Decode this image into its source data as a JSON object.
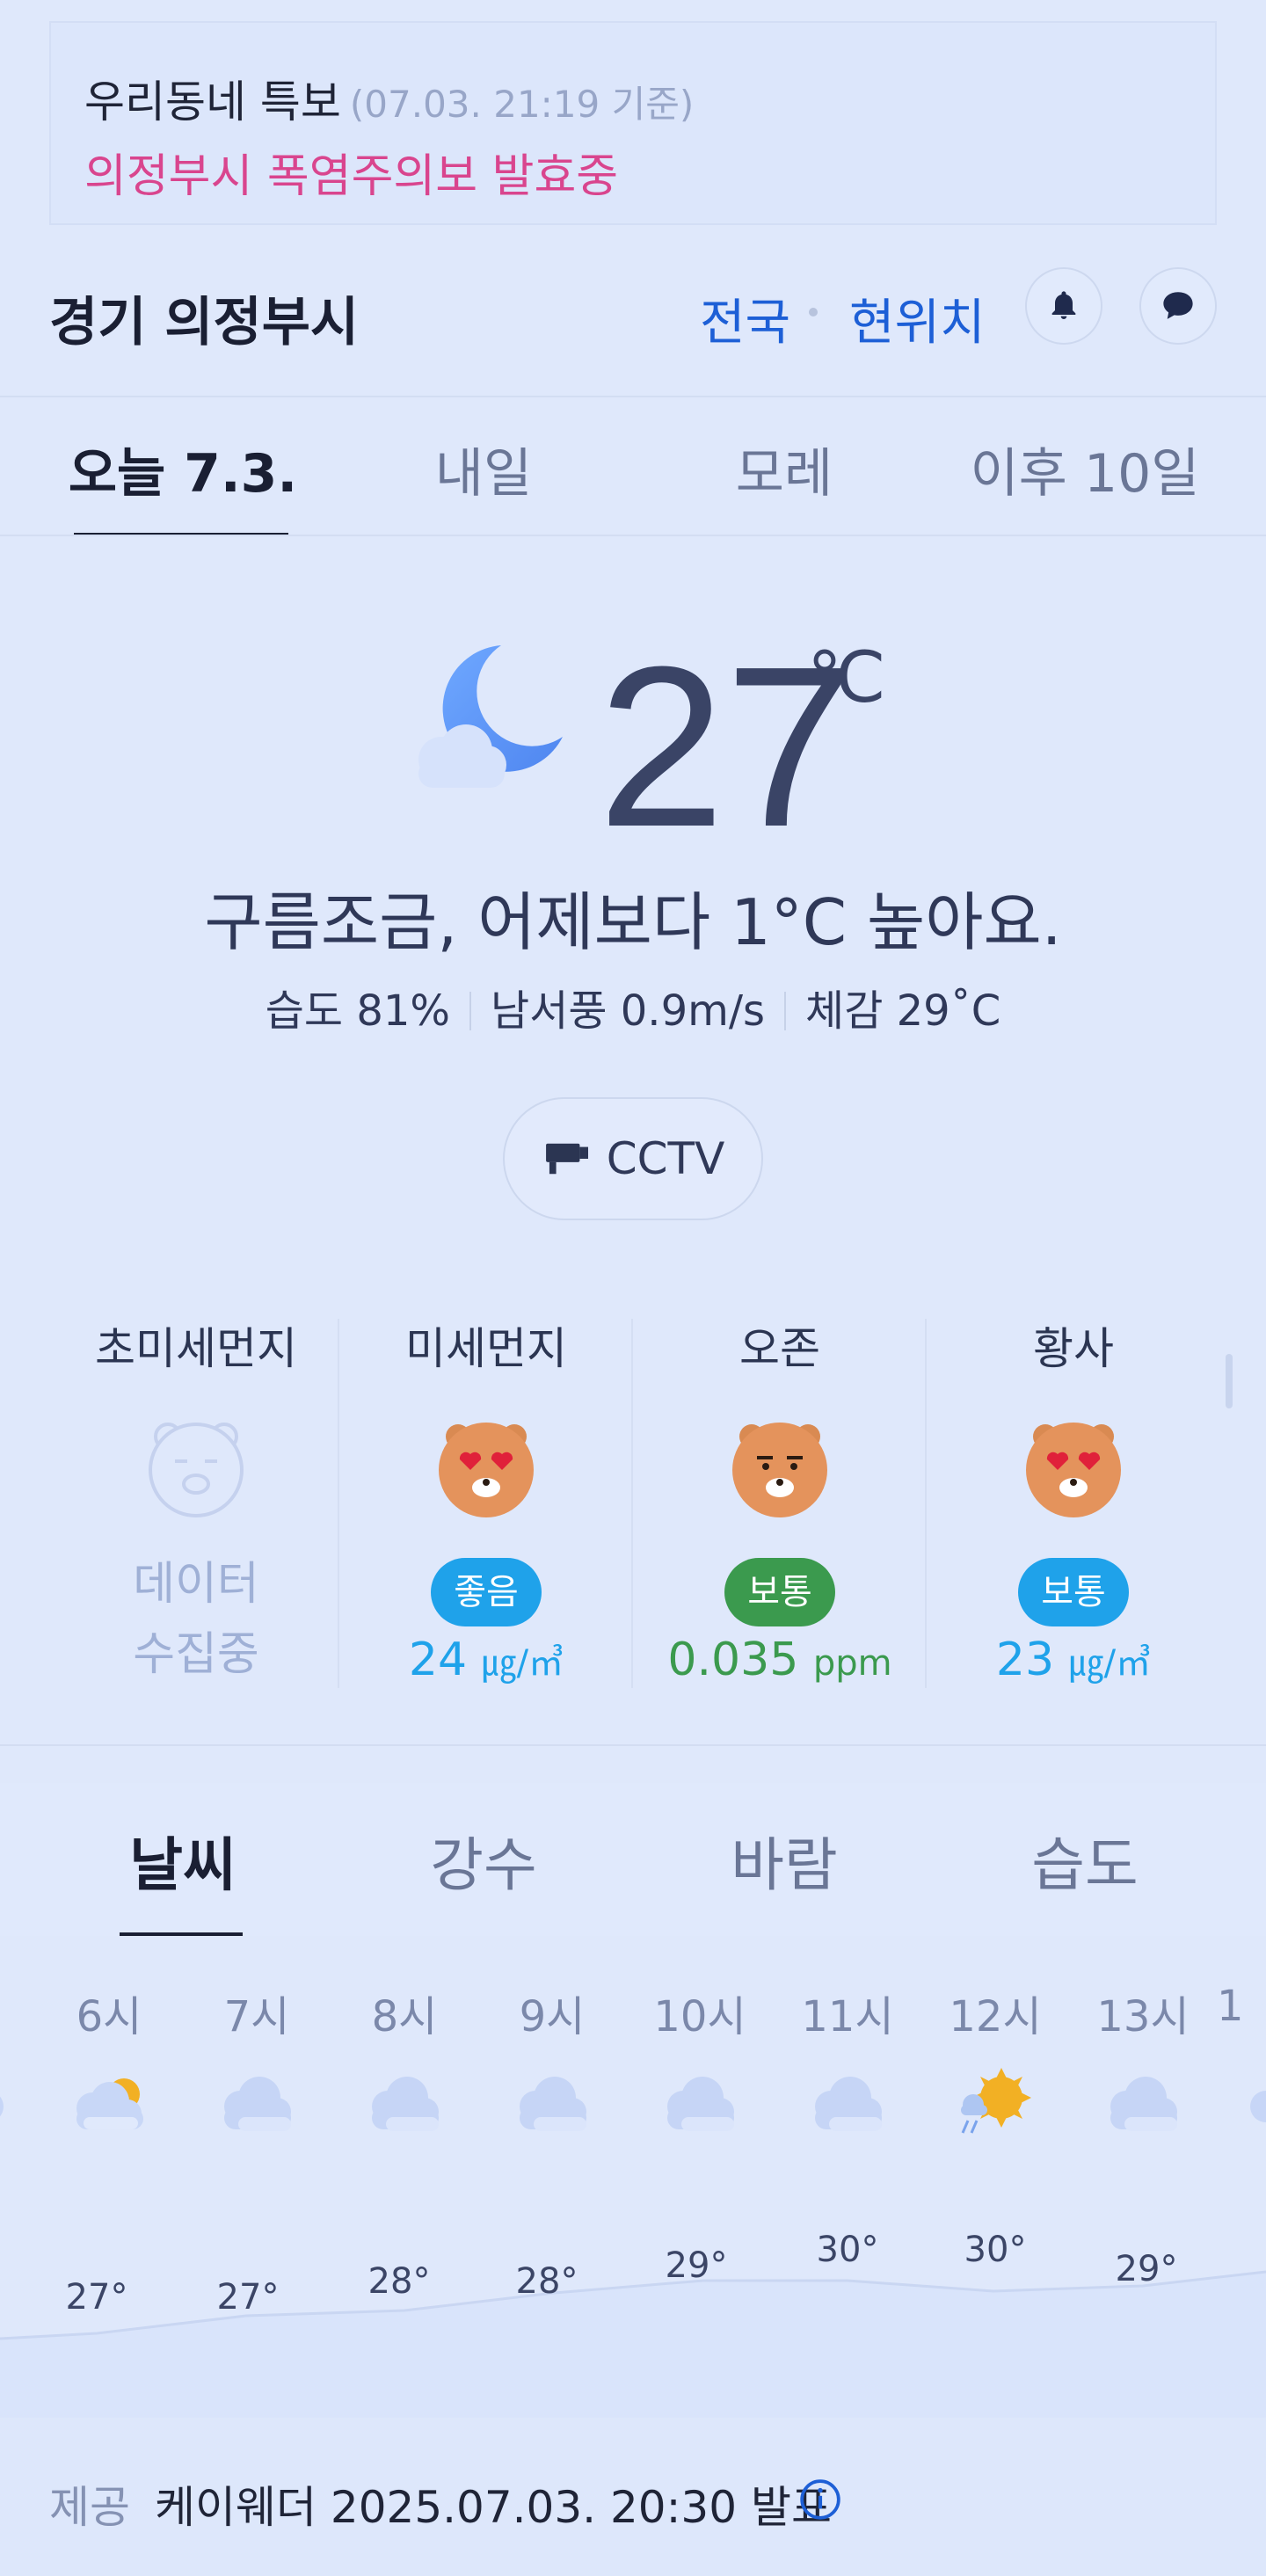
{
  "alert": {
    "title": "우리동네 특보",
    "time": "(07.03. 21:19 기준)",
    "message": "의정부시 폭염주의보 발효중"
  },
  "location": {
    "name": "경기 의정부시",
    "nationwide_link": "전국",
    "current_location_link": "현위치",
    "bell_icon": "bell-icon",
    "chat_icon": "chat-bubble-icon"
  },
  "day_tabs": [
    {
      "label": "오늘 7.3.",
      "active": true
    },
    {
      "label": "내일",
      "active": false
    },
    {
      "label": "모레",
      "active": false
    },
    {
      "label": "이후 10일",
      "active": false
    }
  ],
  "current": {
    "icon": "moon-cloud-icon",
    "temperature": "27",
    "unit": "℃",
    "summary": "구름조금, 어제보다 1°C 높아요.",
    "humidity": "습도 81%",
    "wind": "남서풍 0.9m/s",
    "feels_like": "체감 29˚C",
    "cctv_label": "CCTV"
  },
  "air_quality": [
    {
      "title": "초미세먼지",
      "status": "데이터\n수집중",
      "collecting_line1": "데이터",
      "collecting_line2": "수집중",
      "face": "ryan-inactive"
    },
    {
      "title": "미세먼지",
      "badge": "좋음",
      "value": "24",
      "unit": "㎍/㎥",
      "face": "ryan-heart-eyes",
      "color": "#1fa2ea"
    },
    {
      "title": "오존",
      "badge": "보통",
      "value": "0.035",
      "unit": "ppm",
      "face": "ryan-neutral",
      "color": "#3b9a4e"
    },
    {
      "title": "황사",
      "badge": "보통",
      "value": "23",
      "unit": "㎍/㎥",
      "face": "ryan-heart-eyes",
      "color": "#1fa2ea"
    }
  ],
  "detail_tabs": [
    {
      "label": "날씨",
      "active": true
    },
    {
      "label": "강수",
      "active": false
    },
    {
      "label": "바람",
      "active": false
    },
    {
      "label": "습도",
      "active": false
    }
  ],
  "hourly": [
    {
      "time": "6시",
      "icon": "cloud-sun-icon",
      "temp": "27°"
    },
    {
      "time": "7시",
      "icon": "cloudy-icon",
      "temp": "27°"
    },
    {
      "time": "8시",
      "icon": "cloudy-icon",
      "temp": "28°"
    },
    {
      "time": "9시",
      "icon": "cloudy-icon",
      "temp": "28°"
    },
    {
      "time": "10시",
      "icon": "cloudy-icon",
      "temp": "29°"
    },
    {
      "time": "11시",
      "icon": "cloudy-icon",
      "temp": "30°"
    },
    {
      "time": "12시",
      "icon": "sun-rain-icon",
      "temp": "30°"
    },
    {
      "time": "13시",
      "icon": "cloudy-icon",
      "temp": "29°"
    }
  ],
  "footer": {
    "label": "제공",
    "text": "케이웨더 2025.07.03. 20:30 발표",
    "info_icon": "info-icon"
  },
  "colors": {
    "accent": "#1d5fd6",
    "alert": "#d9458e",
    "good": "#1fa2ea",
    "normal_ozone": "#3b9a4e"
  }
}
